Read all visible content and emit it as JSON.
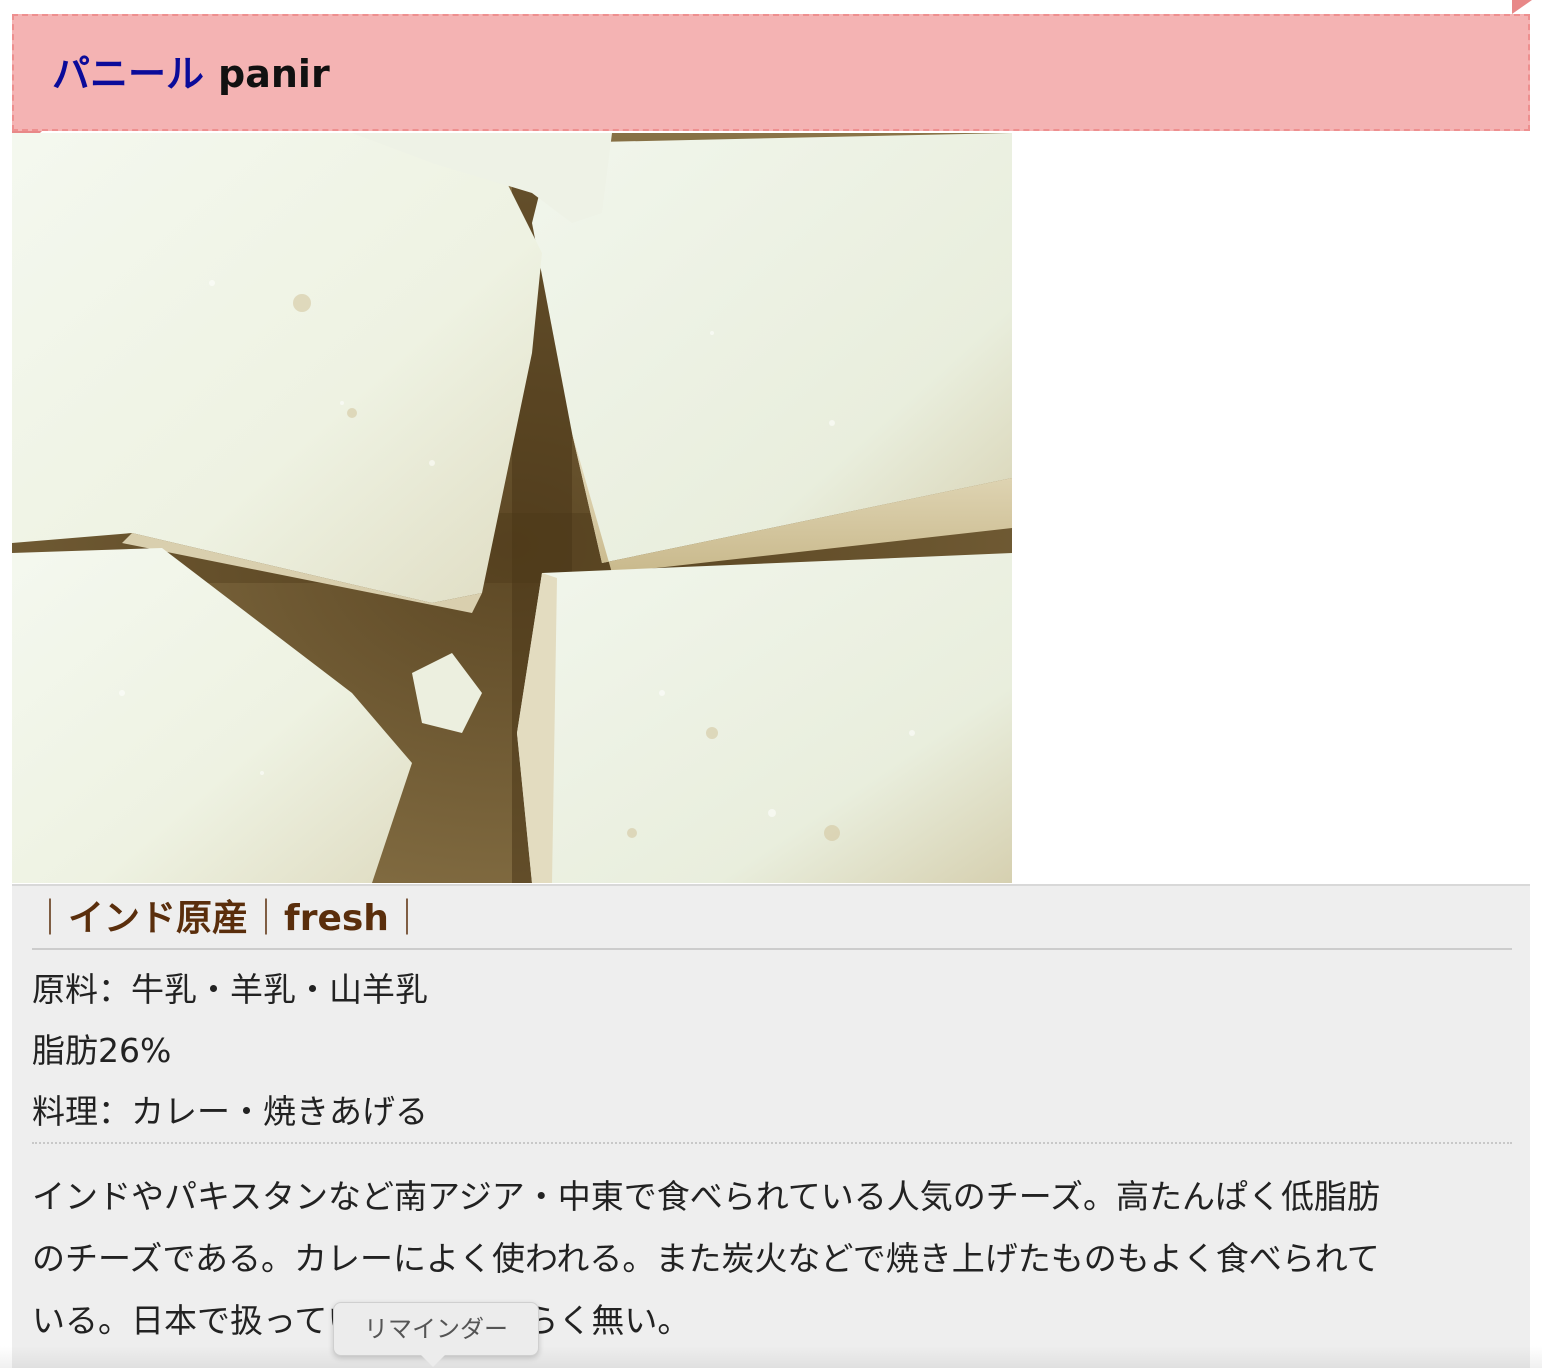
{
  "header": {
    "title_jp": "パニール",
    "title_en": "panir"
  },
  "photo": {
    "alt": "panir cheese cubes"
  },
  "info": {
    "tags": [
      "｜",
      "インド原産",
      "｜",
      "fresh",
      "｜"
    ],
    "specs": [
      "原料：牛乳・羊乳・山羊乳",
      "脂肪26%",
      "料理：カレー・焼きあげる"
    ],
    "description_line1": "インドやパキスタンなど南アジア・中東で食べられている人気のチーズ。高たんぱく低脂肪",
    "description_line2": "のチーズである。カレーによく使われる。また炭火などで焼き上げたものもよく食べられて",
    "description_line3": "いる。日本で扱っているのはおそらく無い。"
  },
  "tooltip": {
    "label": "リマインダー"
  },
  "colors": {
    "ribbon": "#f4b3b3",
    "ribbon_border": "#ee8f8f",
    "title_jp": "#0b0b9a",
    "tag_text": "#5a2e0c",
    "info_bg": "#eeeeee"
  }
}
